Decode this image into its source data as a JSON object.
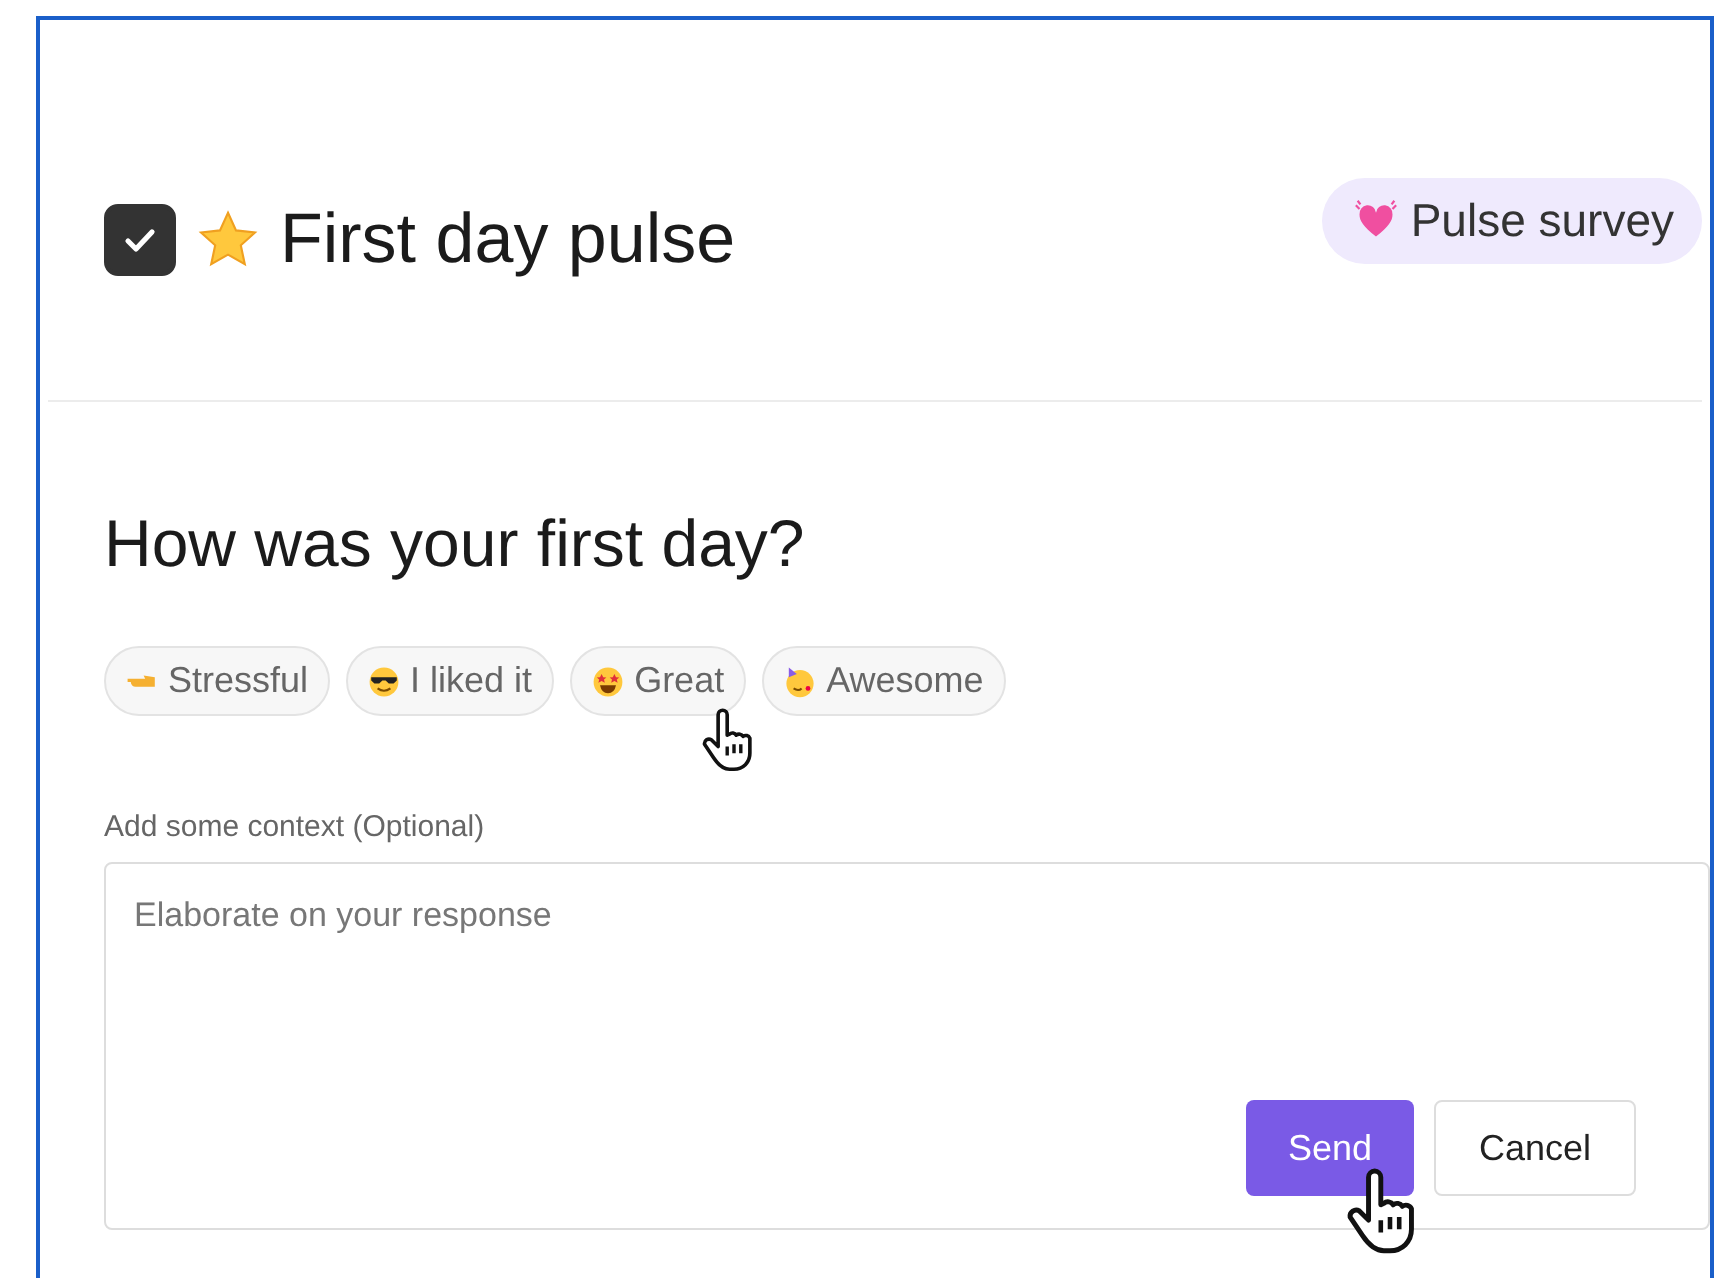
{
  "task": {
    "checked": true,
    "title": "First day pulse",
    "tag": "Pulse survey"
  },
  "question": "How was your first day?",
  "options": [
    {
      "label": "Stressful"
    },
    {
      "label": "I liked it"
    },
    {
      "label": "Great"
    },
    {
      "label": "Awesome"
    }
  ],
  "context": {
    "label": "Add some context (Optional)",
    "placeholder": "Elaborate on your response"
  },
  "buttons": [
    {
      "label": "Send",
      "kind": "primary"
    },
    {
      "label": "Cancel",
      "kind": "secondary"
    }
  ]
}
